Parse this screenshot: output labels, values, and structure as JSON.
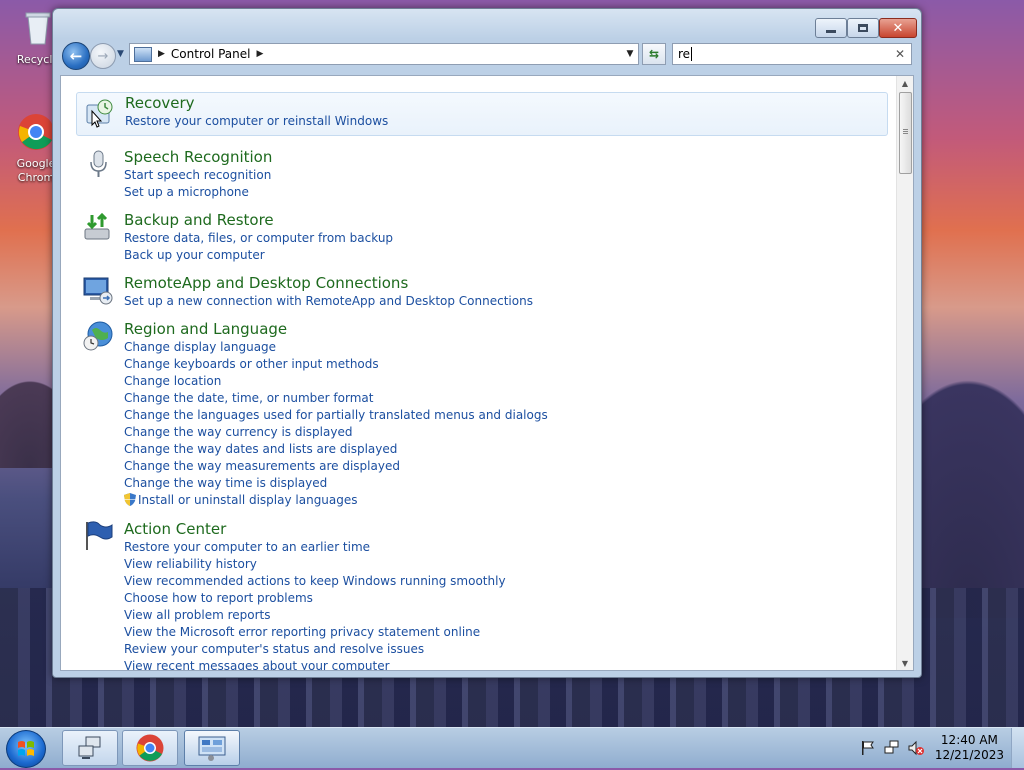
{
  "desktop": {
    "icons": [
      {
        "label": "Recycle"
      },
      {
        "label": "Google Chrom"
      }
    ]
  },
  "window": {
    "address": {
      "crumbs": [
        "Control Panel"
      ]
    },
    "search": {
      "value": "re"
    },
    "groups": [
      {
        "title": "Recovery",
        "links": [
          "Restore your computer or reinstall Windows"
        ]
      },
      {
        "title": "Speech Recognition",
        "links": [
          "Start speech recognition",
          "Set up a microphone"
        ]
      },
      {
        "title": "Backup and Restore",
        "links": [
          "Restore data, files, or computer from backup",
          "Back up your computer"
        ]
      },
      {
        "title": "RemoteApp and Desktop Connections",
        "links": [
          "Set up a new connection with RemoteApp and Desktop Connections"
        ]
      },
      {
        "title": "Region and Language",
        "links": [
          "Change display language",
          "Change keyboards or other input methods",
          "Change location",
          "Change the date, time, or number format",
          "Change the languages used for partially translated menus and dialogs",
          "Change the way currency is displayed",
          "Change the way dates and lists are displayed",
          "Change the way measurements are displayed",
          "Change the way time is displayed",
          "Install or uninstall display languages"
        ]
      },
      {
        "title": "Action Center",
        "links": [
          "Restore your computer to an earlier time",
          "View reliability history",
          "View recommended actions to keep Windows running smoothly",
          "Choose how to report problems",
          "View all problem reports",
          "View the Microsoft error reporting privacy statement online",
          "Review your computer's status and resolve issues",
          "View recent messages about your computer"
        ]
      }
    ]
  },
  "taskbar": {
    "clock": {
      "time": "12:40 AM",
      "date": "12/21/2023"
    }
  }
}
